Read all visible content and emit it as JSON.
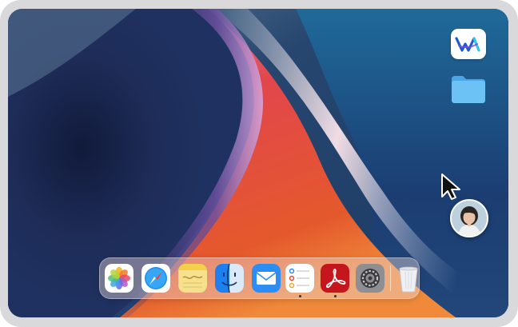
{
  "desktop": {
    "icons": [
      {
        "name": "wrike-app-icon"
      },
      {
        "name": "folder-icon"
      }
    ]
  },
  "dock": {
    "apps": [
      {
        "name": "photos-icon",
        "running": false
      },
      {
        "name": "safari-icon",
        "running": false
      },
      {
        "name": "notes-icon",
        "running": false
      },
      {
        "name": "finder-icon",
        "running": false
      },
      {
        "name": "mail-icon",
        "running": false
      },
      {
        "name": "reminders-icon",
        "running": true
      },
      {
        "name": "acrobat-icon",
        "running": true
      },
      {
        "name": "system-settings-icon",
        "running": false
      },
      {
        "name": "trash-icon",
        "running": false
      }
    ]
  },
  "colors": {
    "frame": "#d9d9dc",
    "wallpaper_blue": "#1d3a66",
    "wallpaper_red": "#e2463f",
    "wallpaper_orange": "#f07a3a",
    "folder_blue": "#5fb8f2",
    "acrobat_red": "#c4161c"
  }
}
